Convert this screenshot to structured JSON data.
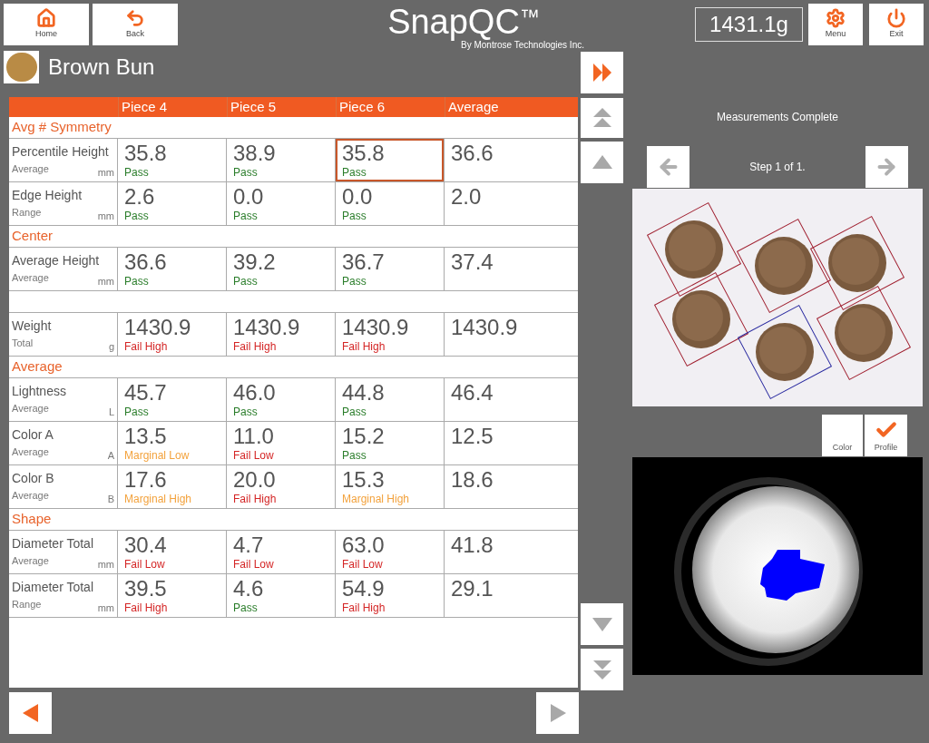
{
  "header": {
    "buttons": [
      {
        "kind": "home",
        "label": "Home"
      },
      {
        "kind": "back",
        "label": "Back"
      }
    ],
    "title": "SnapQC$^{™}$",
    "subtitle": "By Montrose Technologies Inc.",
    "scale_reading": "1431.1g",
    "right_buttons": [
      {
        "kind": "menu",
        "label": "Menu"
      },
      {
        "kind": "exit",
        "label": "Exit"
      }
    ]
  },
  "product": {
    "name": "Brown Bun"
  },
  "table": {
    "columns": [
      "Piece 4",
      "Piece 5",
      "Piece 6",
      "Average"
    ],
    "rows": [
      {
        "kind": "section",
        "label": "Avg # Symmetry"
      },
      {
        "kind": "measure",
        "name": "Percentile Height",
        "sub": "Average",
        "unit": "mm",
        "cells": [
          {
            "value": "35.8",
            "status": "Pass",
            "color": "#2a7d2a",
            "selected": false
          },
          {
            "value": "38.9",
            "status": "Pass",
            "color": "#2a7d2a",
            "selected": false
          },
          {
            "value": "35.8",
            "status": "Pass",
            "color": "#2a7d2a",
            "selected": true
          }
        ],
        "average": "36.6"
      },
      {
        "kind": "measure",
        "name": "Edge Height",
        "sub": "Range",
        "unit": "mm",
        "cells": [
          {
            "value": "2.6",
            "status": "Pass",
            "color": "#2a7d2a",
            "selected": false
          },
          {
            "value": "0.0",
            "status": "Pass",
            "color": "#2a7d2a",
            "selected": false
          },
          {
            "value": "0.0",
            "status": "Pass",
            "color": "#2a7d2a",
            "selected": false
          }
        ],
        "average": "2.0"
      },
      {
        "kind": "section",
        "label": "Center"
      },
      {
        "kind": "measure",
        "name": "Average Height",
        "sub": "Average",
        "unit": "mm",
        "cells": [
          {
            "value": "36.6",
            "status": "Pass",
            "color": "#2a7d2a",
            "selected": false
          },
          {
            "value": "39.2",
            "status": "Pass",
            "color": "#2a7d2a",
            "selected": false
          },
          {
            "value": "36.7",
            "status": "Pass",
            "color": "#2a7d2a",
            "selected": false
          }
        ],
        "average": "37.4"
      },
      {
        "kind": "blank"
      },
      {
        "kind": "measure",
        "name": "Weight",
        "sub": "Total",
        "unit": "g",
        "cells": [
          {
            "value": "1430.9",
            "status": "Fail High",
            "color": "#d42525",
            "selected": false
          },
          {
            "value": "1430.9",
            "status": "Fail High",
            "color": "#d42525",
            "selected": false
          },
          {
            "value": "1430.9",
            "status": "Fail High",
            "color": "#d42525",
            "selected": false
          }
        ],
        "average": "1430.9"
      },
      {
        "kind": "section",
        "label": "Average"
      },
      {
        "kind": "measure",
        "name": "Lightness",
        "sub": "Average",
        "unit": "L",
        "cells": [
          {
            "value": "45.7",
            "status": "Pass",
            "color": "#2a7d2a",
            "selected": false
          },
          {
            "value": "46.0",
            "status": "Pass",
            "color": "#2a7d2a",
            "selected": false
          },
          {
            "value": "44.8",
            "status": "Pass",
            "color": "#2a7d2a",
            "selected": false
          }
        ],
        "average": "46.4"
      },
      {
        "kind": "measure",
        "name": "Color A",
        "sub": "Average",
        "unit": "A",
        "cells": [
          {
            "value": "13.5",
            "status": "Marginal Low",
            "color": "#f3a23c",
            "selected": false
          },
          {
            "value": "11.0",
            "status": "Fail Low",
            "color": "#d42525",
            "selected": false
          },
          {
            "value": "15.2",
            "status": "Pass",
            "color": "#2a7d2a",
            "selected": false
          }
        ],
        "average": "12.5"
      },
      {
        "kind": "measure",
        "name": "Color B",
        "sub": "Average",
        "unit": "B",
        "cells": [
          {
            "value": "17.6",
            "status": "Marginal High",
            "color": "#f3a23c",
            "selected": false
          },
          {
            "value": "20.0",
            "status": "Fail High",
            "color": "#d42525",
            "selected": false
          },
          {
            "value": "15.3",
            "status": "Marginal High",
            "color": "#f3a23c",
            "selected": false
          }
        ],
        "average": "18.6"
      },
      {
        "kind": "section",
        "label": "Shape"
      },
      {
        "kind": "measure",
        "name": "Diameter Total",
        "sub": "Average",
        "unit": "mm",
        "cells": [
          {
            "value": "30.4",
            "status": "Fail Low",
            "color": "#d42525",
            "selected": false
          },
          {
            "value": "4.7",
            "status": "Fail Low",
            "color": "#d42525",
            "selected": false
          },
          {
            "value": "63.0",
            "status": "Fail Low",
            "color": "#d42525",
            "selected": false
          }
        ],
        "average": "41.8"
      },
      {
        "kind": "measure",
        "name": "Diameter Total",
        "sub": "Range",
        "unit": "mm",
        "cells": [
          {
            "value": "39.5",
            "status": "Fail High",
            "color": "#d42525",
            "selected": false
          },
          {
            "value": "4.6",
            "status": "Pass",
            "color": "#2a7d2a",
            "selected": false
          },
          {
            "value": "54.9",
            "status": "Fail High",
            "color": "#d42525",
            "selected": false
          }
        ],
        "average": "29.1"
      }
    ]
  },
  "scroll_buttons": [
    {
      "kind": "skip-forward",
      "disabled": false
    },
    {
      "kind": "top",
      "disabled": true
    },
    {
      "kind": "up",
      "disabled": true
    },
    {
      "kind": "down",
      "disabled": true
    },
    {
      "kind": "bottom",
      "disabled": true
    }
  ],
  "page_nav": [
    {
      "kind": "previous",
      "disabled": false
    },
    {
      "kind": "next",
      "disabled": true
    }
  ],
  "panel": {
    "status": "Measurements Complete",
    "step": "Step 1 of 1.",
    "step_buttons": [
      {
        "kind": "previous",
        "disabled": true
      },
      {
        "kind": "next",
        "disabled": true
      }
    ],
    "views": [
      {
        "label": "Color",
        "selected": false
      },
      {
        "label": "Profile",
        "selected": true
      }
    ]
  }
}
